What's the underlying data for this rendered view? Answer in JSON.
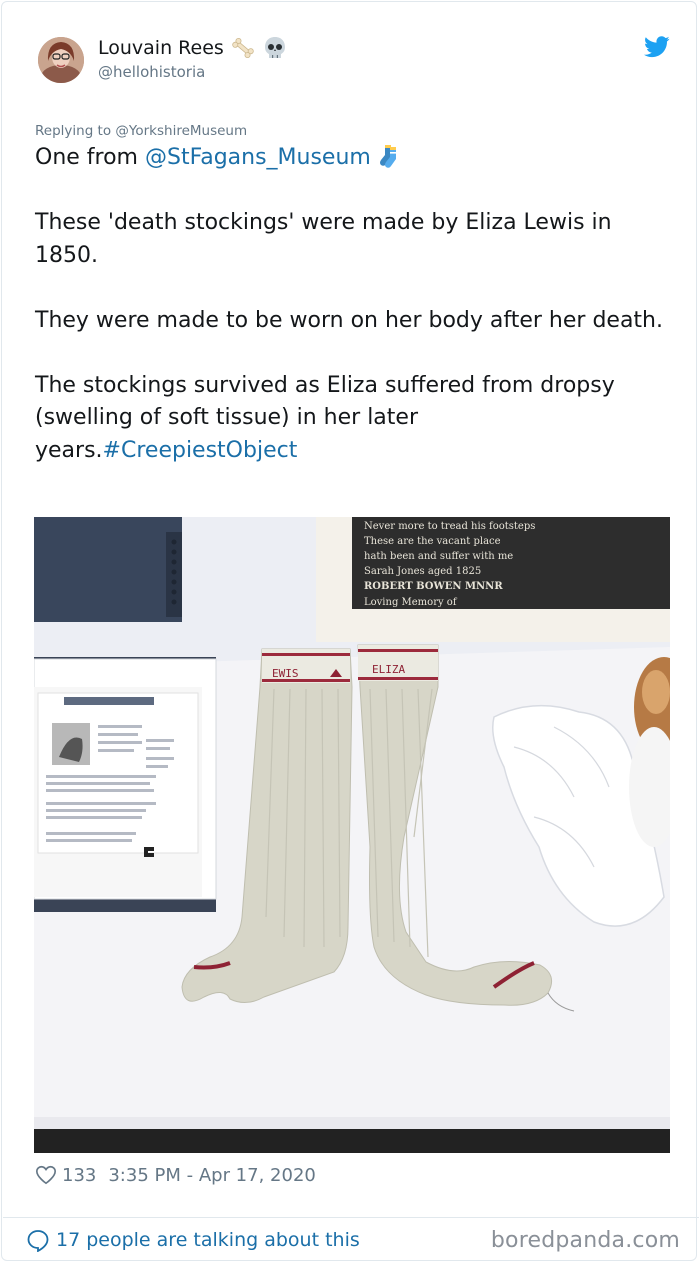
{
  "author": {
    "display_name": "Louvain Rees",
    "handle": "@hellohistoria",
    "name_emojis": [
      "bone-icon",
      "skull-icon"
    ]
  },
  "reply_context": "Replying to @YorkshireMuseum",
  "tweet": {
    "line1_prefix": "One from ",
    "line1_mention": "@StFagans_Museum",
    "line1_emoji": "socks-icon",
    "para2": "These 'death stockings' were made by Eliza Lewis in 1850.",
    "para3": "They were made to be worn on her body after her death.",
    "para4_text": "The stockings survived as Eliza suffered from dropsy (swelling of soft tissue) in her later years.",
    "para4_hashtag": "#CreepiestObject"
  },
  "photo": {
    "stocking_knit_left": "EWIS",
    "stocking_knit_right": "ELIZA",
    "sampler_lines": [
      "Never more to tread his footsteps",
      "These are the vacant place",
      "hath been and suffer with me",
      "Sarah Jones aged 1825",
      "ROBERT BOWEN MNNR",
      "Loving Memory of"
    ]
  },
  "meta": {
    "likes": "133",
    "timestamp": "3:35 PM - Apr 17, 2020"
  },
  "footer": {
    "talking": "17 people are talking about this",
    "watermark": "boredpanda.com"
  },
  "colors": {
    "link": "#1b6fa8",
    "twitter_blue": "#1da1f2",
    "muted": "#657786"
  }
}
